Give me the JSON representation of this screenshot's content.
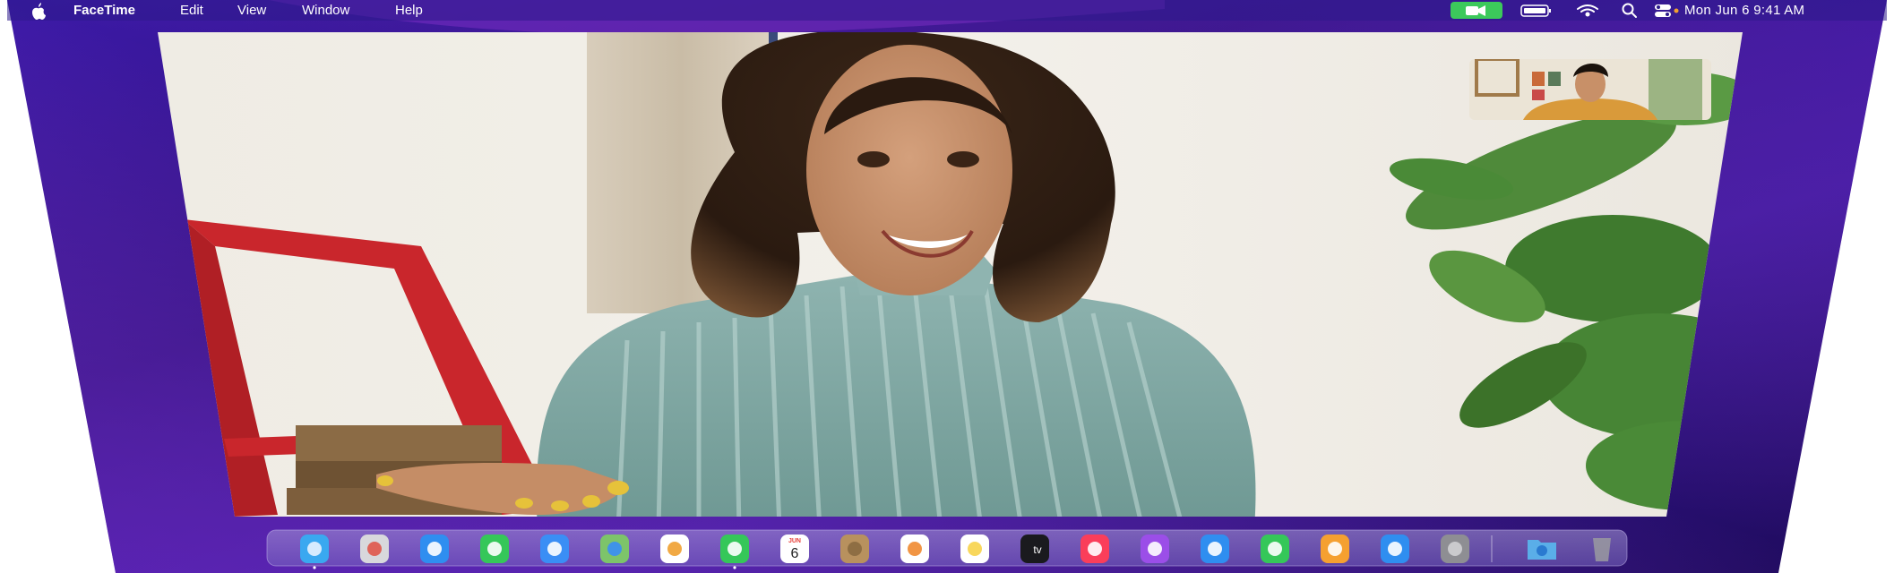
{
  "menubar": {
    "app_name": "FaceTime",
    "items": [
      "Edit",
      "View",
      "Window",
      "Help"
    ],
    "clock": "Mon Jun 6  9:41 AM"
  },
  "facetime": {
    "remote_caller": "woman-in-striped-turtleneck",
    "self_view": "man-in-orange-shirt"
  },
  "dock": {
    "apps": [
      {
        "name": "Finder",
        "icon": "finder-icon"
      },
      {
        "name": "Launchpad",
        "icon": "launchpad-icon"
      },
      {
        "name": "Safari",
        "icon": "safari-icon"
      },
      {
        "name": "Messages",
        "icon": "messages-icon"
      },
      {
        "name": "Mail",
        "icon": "mail-icon"
      },
      {
        "name": "Maps",
        "icon": "maps-icon"
      },
      {
        "name": "Photos",
        "icon": "photos-icon"
      },
      {
        "name": "FaceTime",
        "icon": "facetime-icon"
      },
      {
        "name": "Calendar",
        "icon": "calendar-icon"
      },
      {
        "name": "Contacts",
        "icon": "contacts-icon"
      },
      {
        "name": "Reminders",
        "icon": "reminders-icon"
      },
      {
        "name": "Notes",
        "icon": "notes-icon"
      },
      {
        "name": "TV",
        "icon": "tv-icon"
      },
      {
        "name": "Music",
        "icon": "music-icon"
      },
      {
        "name": "Podcasts",
        "icon": "podcasts-icon"
      },
      {
        "name": "Keynote",
        "icon": "keynote-icon"
      },
      {
        "name": "Numbers",
        "icon": "numbers-icon"
      },
      {
        "name": "Pages",
        "icon": "pages-icon"
      },
      {
        "name": "App Store",
        "icon": "app-store-icon"
      },
      {
        "name": "System Preferences",
        "icon": "system-preferences-icon"
      },
      {
        "name": "Downloads",
        "icon": "downloads-folder-icon"
      },
      {
        "name": "Trash",
        "icon": "trash-icon"
      }
    ],
    "calendar_month": "JUN",
    "calendar_day": "6",
    "tv_label": "tv"
  },
  "colors": {
    "wallpaper_dark": "#2a0f7a",
    "wallpaper_light": "#8a3fe0",
    "facetime_green": "#3cc95b"
  }
}
